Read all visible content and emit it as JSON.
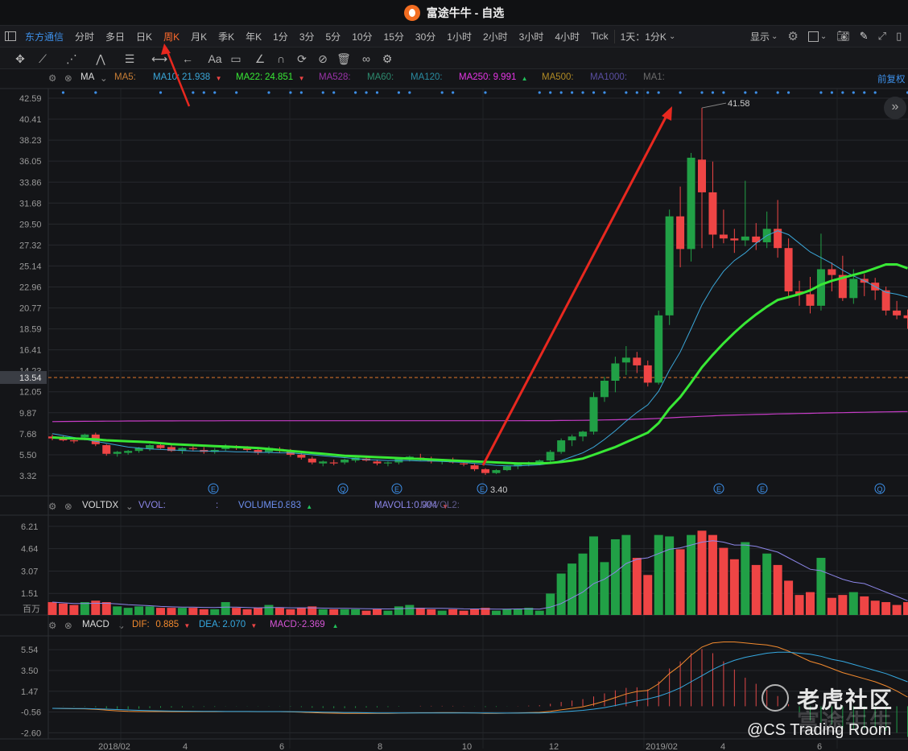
{
  "window": {
    "title": "富途牛牛 - 自选"
  },
  "toolbar": {
    "left_items": [
      {
        "label": "东方通信",
        "style": "blue"
      },
      {
        "label": "分时",
        "style": "normal"
      },
      {
        "label": "多日",
        "style": "normal"
      },
      {
        "label": "日K",
        "style": "normal"
      },
      {
        "label": "周K",
        "style": "active"
      },
      {
        "label": "月K",
        "style": "normal"
      },
      {
        "label": "季K",
        "style": "normal"
      },
      {
        "label": "年K",
        "style": "normal"
      },
      {
        "label": "1分",
        "style": "normal"
      },
      {
        "label": "3分",
        "style": "normal"
      },
      {
        "label": "5分",
        "style": "normal"
      },
      {
        "label": "10分",
        "style": "normal"
      },
      {
        "label": "15分",
        "style": "normal"
      },
      {
        "label": "30分",
        "style": "normal"
      },
      {
        "label": "1小时",
        "style": "normal"
      },
      {
        "label": "2小时",
        "style": "normal"
      },
      {
        "label": "3小时",
        "style": "normal"
      },
      {
        "label": "4小时",
        "style": "normal"
      },
      {
        "label": "Tick",
        "style": "normal"
      },
      {
        "label": "1天：1分K",
        "style": "normal"
      }
    ],
    "display_label": "显示"
  },
  "ma_bar": {
    "name": "MA",
    "items": [
      {
        "label": "MA5:",
        "value": "",
        "color": "#c87d35"
      },
      {
        "label": "MA10:",
        "value": "21.938",
        "color": "#3aa6d8",
        "arrow": "▼"
      },
      {
        "label": "MA22:",
        "value": "24.851",
        "color": "#38e835",
        "arrow": "▼"
      },
      {
        "label": "MA528:",
        "value": "",
        "color": "#9a33a8"
      },
      {
        "label": "MA60:",
        "value": "",
        "color": "#2d8a6e"
      },
      {
        "label": "MA120:",
        "value": "",
        "color": "#2a8ba0"
      },
      {
        "label": "MA250:",
        "value": "9.991",
        "color": "#e436e4",
        "arrow": "▲"
      },
      {
        "label": "MA500:",
        "value": "",
        "color": "#b08a25"
      },
      {
        "label": "MA1000:",
        "value": "",
        "color": "#5a4ea0"
      },
      {
        "label": "MA1:",
        "value": "",
        "color": "#6b6b6b"
      }
    ],
    "right_label": "前复权"
  },
  "vol_bar": {
    "name": "VOLTDX",
    "items": [
      {
        "label": "VVOL:",
        "value": "",
        "color": "#8c86e8"
      },
      {
        "label": ":",
        "value": "",
        "color": "#8c86e8"
      },
      {
        "label": "VOLUME:",
        "value": "0.883",
        "color": "#6d8ff0",
        "arrow": "▲"
      },
      {
        "label": "MAVOL1:",
        "value": "0.904",
        "color": "#8c86e8",
        "arrow": "▼"
      },
      {
        "label": "MAVOL2:",
        "value": "",
        "color": "#5f5a8a"
      }
    ]
  },
  "macd_bar": {
    "name": "MACD",
    "items": [
      {
        "label": "DIF:",
        "value": "0.885",
        "color": "#f28a2e",
        "arrow": "▼"
      },
      {
        "label": "DEA:",
        "value": "2.070",
        "color": "#35a8e0",
        "arrow": "▼"
      },
      {
        "label": "MACD:",
        "value": "-2.369",
        "color": "#d655d6",
        "arrow": "▲"
      }
    ]
  },
  "colors": {
    "up": "#ef4545",
    "down": "#21a046",
    "bg": "#141518",
    "grid": "#26282d",
    "accent": "#3d8fe8",
    "ma10": "#3aa6d8",
    "ma22": "#38e835",
    "ma250": "#c63cc6",
    "dif": "#f28a2e",
    "dea": "#35a8e0",
    "vol_ma": "#8c86e8"
  },
  "main_axis": {
    "ticks": [
      "42.59",
      "40.41",
      "38.23",
      "36.05",
      "33.86",
      "31.68",
      "29.50",
      "27.32",
      "25.14",
      "22.96",
      "20.77",
      "18.59",
      "16.41",
      "14.23",
      "12.05",
      "9.87",
      "7.68",
      "5.50",
      "3.32"
    ],
    "current_price": "13.54"
  },
  "vol_axis": {
    "ticks": [
      "6.21",
      "4.64",
      "3.07",
      "1.51"
    ],
    "unit": "百万"
  },
  "macd_axis": {
    "ticks": [
      "5.54",
      "3.50",
      "1.47",
      "-0.56",
      "-2.60"
    ]
  },
  "x_axis": {
    "labels": [
      "2018/02",
      "4",
      "6",
      "8",
      "10",
      "12",
      "2019/02",
      "4",
      "6"
    ]
  },
  "annotations": {
    "high_label": "41.58",
    "low_label": "3.40",
    "event_markers": [
      "E",
      "Q",
      "E",
      "E",
      "E",
      "E",
      "Q"
    ]
  },
  "watermark": {
    "brand": "老虎社区",
    "brand2": "富途牛牛",
    "handle": "@CS Trading Room"
  },
  "chart_data": {
    "type": "candlestick",
    "series_note": "Weekly candles; each row [open, high, low, close, volume_millions]",
    "candles": [
      [
        7.4,
        7.6,
        7.0,
        7.2,
        0.9
      ],
      [
        7.2,
        7.5,
        6.9,
        7.0,
        0.8
      ],
      [
        7.0,
        7.3,
        6.7,
        6.9,
        0.7
      ],
      [
        7.3,
        7.7,
        7.0,
        7.6,
        0.9
      ],
      [
        7.6,
        7.8,
        6.4,
        6.6,
        1.0
      ],
      [
        6.5,
        6.6,
        5.4,
        5.6,
        0.9
      ],
      [
        5.6,
        5.9,
        5.3,
        5.8,
        0.6
      ],
      [
        5.7,
        6.0,
        5.5,
        5.9,
        0.5
      ],
      [
        5.9,
        6.3,
        5.7,
        6.2,
        0.6
      ],
      [
        6.1,
        6.6,
        5.9,
        6.5,
        0.6
      ],
      [
        6.5,
        6.7,
        6.1,
        6.2,
        0.5
      ],
      [
        6.3,
        6.5,
        5.8,
        5.9,
        0.5
      ],
      [
        5.9,
        6.3,
        5.6,
        6.2,
        0.5
      ],
      [
        6.2,
        6.4,
        5.9,
        6.1,
        0.5
      ],
      [
        6.0,
        6.3,
        5.6,
        5.8,
        0.4
      ],
      [
        5.8,
        6.2,
        5.6,
        6.0,
        0.4
      ],
      [
        6.1,
        6.6,
        5.9,
        6.4,
        0.9
      ],
      [
        6.4,
        6.5,
        6.0,
        6.2,
        0.5
      ],
      [
        6.2,
        6.4,
        5.8,
        6.0,
        0.4
      ],
      [
        6.0,
        6.2,
        5.5,
        5.7,
        0.5
      ],
      [
        5.8,
        6.4,
        5.6,
        6.2,
        0.7
      ],
      [
        6.1,
        6.3,
        5.7,
        5.9,
        0.5
      ],
      [
        5.9,
        6.1,
        5.3,
        5.5,
        0.4
      ],
      [
        5.5,
        5.7,
        5.0,
        5.2,
        0.5
      ],
      [
        5.1,
        5.3,
        4.5,
        4.7,
        0.6
      ],
      [
        4.6,
        4.9,
        4.3,
        4.8,
        0.4
      ],
      [
        4.7,
        5.0,
        4.4,
        4.6,
        0.4
      ],
      [
        4.7,
        5.1,
        4.5,
        5.0,
        0.4
      ],
      [
        4.9,
        5.3,
        4.7,
        5.2,
        0.4
      ],
      [
        5.1,
        5.3,
        4.8,
        4.9,
        0.3
      ],
      [
        4.8,
        5.0,
        4.4,
        4.6,
        0.4
      ],
      [
        4.6,
        4.8,
        4.3,
        4.7,
        0.3
      ],
      [
        4.7,
        5.2,
        4.5,
        5.1,
        0.6
      ],
      [
        5.0,
        5.4,
        4.8,
        5.3,
        0.7
      ],
      [
        5.2,
        5.6,
        4.9,
        5.1,
        0.5
      ],
      [
        5.0,
        5.3,
        4.6,
        4.8,
        0.4
      ],
      [
        4.8,
        5.0,
        4.5,
        4.9,
        0.3
      ],
      [
        4.9,
        5.2,
        4.6,
        4.7,
        0.4
      ],
      [
        4.6,
        4.8,
        4.3,
        4.5,
        0.3
      ],
      [
        4.4,
        4.6,
        3.8,
        4.0,
        0.4
      ],
      [
        4.0,
        4.1,
        3.4,
        3.6,
        0.5
      ],
      [
        3.6,
        4.0,
        3.5,
        3.9,
        0.3
      ],
      [
        3.9,
        4.4,
        3.8,
        4.3,
        0.4
      ],
      [
        4.3,
        4.6,
        4.0,
        4.5,
        0.4
      ],
      [
        4.5,
        4.8,
        4.3,
        4.6,
        0.5
      ],
      [
        4.6,
        5.0,
        4.4,
        4.9,
        0.3
      ],
      [
        4.9,
        6.0,
        4.7,
        5.8,
        1.5
      ],
      [
        5.8,
        7.2,
        5.6,
        7.0,
        2.9
      ],
      [
        7.0,
        7.6,
        6.4,
        7.4,
        3.6
      ],
      [
        7.4,
        8.0,
        6.9,
        7.9,
        4.3
      ],
      [
        7.9,
        12.0,
        7.6,
        11.5,
        5.5
      ],
      [
        11.5,
        13.6,
        11.0,
        13.2,
        3.7
      ],
      [
        13.2,
        15.7,
        12.0,
        15.0,
        5.3
      ],
      [
        15.1,
        16.8,
        13.8,
        15.6,
        5.6
      ],
      [
        15.6,
        16.2,
        14.0,
        14.8,
        4.0
      ],
      [
        14.8,
        15.3,
        12.6,
        13.0,
        2.8
      ],
      [
        13.0,
        20.5,
        12.8,
        20.0,
        5.6
      ],
      [
        20.0,
        31.0,
        19.0,
        30.3,
        5.5
      ],
      [
        30.3,
        33.4,
        25.0,
        26.9,
        4.6
      ],
      [
        26.9,
        36.9,
        25.6,
        36.4,
        5.6
      ],
      [
        36.2,
        41.58,
        27.0,
        32.8,
        5.9
      ],
      [
        32.8,
        36.0,
        27.0,
        28.4,
        5.6
      ],
      [
        28.4,
        31.0,
        27.5,
        28.0,
        4.7
      ],
      [
        28.0,
        29.0,
        26.5,
        27.8,
        3.9
      ],
      [
        27.8,
        34.0,
        27.2,
        28.2,
        5.1
      ],
      [
        28.2,
        29.6,
        26.8,
        27.6,
        3.5
      ],
      [
        27.6,
        30.8,
        27.0,
        29.0,
        4.3
      ],
      [
        29.0,
        32.0,
        26.0,
        27.0,
        3.5
      ],
      [
        27.0,
        28.0,
        21.8,
        22.5,
        2.4
      ],
      [
        22.5,
        23.6,
        21.0,
        22.2,
        1.4
      ],
      [
        22.2,
        24.0,
        20.2,
        21.0,
        1.6
      ],
      [
        21.0,
        28.5,
        20.5,
        24.8,
        4.0
      ],
      [
        24.8,
        25.5,
        22.5,
        24.2,
        1.2
      ],
      [
        24.2,
        26.2,
        21.5,
        21.8,
        1.4
      ],
      [
        21.8,
        24.8,
        21.2,
        23.8,
        1.6
      ],
      [
        23.8,
        24.3,
        22.0,
        23.4,
        1.3
      ],
      [
        23.4,
        23.9,
        21.6,
        22.6,
        1.0
      ],
      [
        22.6,
        23.0,
        20.0,
        20.5,
        0.9
      ],
      [
        20.5,
        21.5,
        19.6,
        20.0,
        0.7
      ],
      [
        20.0,
        20.6,
        18.6,
        19.7,
        0.9
      ]
    ],
    "ma10": [
      7.7,
      7.5,
      7.3,
      7.1,
      6.9,
      6.7,
      6.5,
      6.3,
      6.2,
      6.1,
      6.05,
      6.0,
      5.95,
      5.9,
      5.9,
      5.85,
      5.85,
      5.8,
      5.8,
      5.75,
      5.75,
      5.7,
      5.7,
      5.6,
      5.5,
      5.4,
      5.3,
      5.2,
      5.1,
      5.0,
      4.95,
      4.9,
      4.9,
      4.9,
      4.85,
      4.85,
      4.8,
      4.75,
      4.7,
      4.6,
      4.5,
      4.4,
      4.35,
      4.35,
      4.4,
      4.45,
      4.6,
      4.9,
      5.3,
      5.7,
      6.3,
      7.1,
      8.0,
      9.0,
      9.9,
      10.7,
      12.1,
      14.3,
      16.2,
      18.6,
      21.1,
      23.0,
      24.6,
      25.7,
      26.5,
      27.5,
      28.3,
      28.8,
      28.4,
      27.5,
      26.6,
      26.0,
      25.4,
      24.7,
      24.1,
      23.6,
      23.0,
      22.4,
      22.2,
      21.9
    ],
    "ma22": [
      7.3,
      7.25,
      7.2,
      7.15,
      7.1,
      7.0,
      6.95,
      6.9,
      6.85,
      6.8,
      6.7,
      6.6,
      6.55,
      6.5,
      6.45,
      6.4,
      6.35,
      6.3,
      6.25,
      6.2,
      6.1,
      6.0,
      5.9,
      5.8,
      5.7,
      5.6,
      5.5,
      5.4,
      5.35,
      5.3,
      5.25,
      5.2,
      5.15,
      5.1,
      5.05,
      5.0,
      4.95,
      4.9,
      4.85,
      4.8,
      4.75,
      4.7,
      4.65,
      4.6,
      4.6,
      4.6,
      4.65,
      4.75,
      4.9,
      5.1,
      5.5,
      5.9,
      6.3,
      6.8,
      7.3,
      7.8,
      8.8,
      10.3,
      11.5,
      13.0,
      14.6,
      15.9,
      17.1,
      18.2,
      19.2,
      20.1,
      20.9,
      21.6,
      21.9,
      22.2,
      22.6,
      23.2,
      23.6,
      23.9,
      24.2,
      24.5,
      24.9,
      25.3,
      25.3,
      24.9
    ],
    "ma250": [
      8.95,
      8.96,
      8.97,
      8.98,
      8.99,
      9.0,
      9.0,
      9.01,
      9.01,
      9.02,
      9.02,
      9.02,
      9.03,
      9.03,
      9.03,
      9.03,
      9.04,
      9.04,
      9.04,
      9.04,
      9.04,
      9.04,
      9.04,
      9.04,
      9.04,
      9.04,
      9.04,
      9.04,
      9.04,
      9.04,
      9.04,
      9.04,
      9.04,
      9.04,
      9.04,
      9.04,
      9.04,
      9.04,
      9.04,
      9.04,
      9.04,
      9.04,
      9.04,
      9.04,
      9.05,
      9.05,
      9.05,
      9.06,
      9.07,
      9.08,
      9.1,
      9.12,
      9.14,
      9.17,
      9.2,
      9.23,
      9.28,
      9.34,
      9.4,
      9.45,
      9.5,
      9.55,
      9.6,
      9.63,
      9.66,
      9.69,
      9.72,
      9.75,
      9.77,
      9.79,
      9.81,
      9.84,
      9.86,
      9.88,
      9.9,
      9.92,
      9.94,
      9.96,
      9.98,
      9.99
    ],
    "vol_ma": [
      0.9,
      0.85,
      0.8,
      0.8,
      0.82,
      0.82,
      0.78,
      0.72,
      0.68,
      0.65,
      0.6,
      0.57,
      0.55,
      0.55,
      0.53,
      0.52,
      0.55,
      0.55,
      0.52,
      0.5,
      0.52,
      0.52,
      0.5,
      0.5,
      0.5,
      0.48,
      0.47,
      0.46,
      0.45,
      0.44,
      0.43,
      0.42,
      0.44,
      0.46,
      0.47,
      0.47,
      0.46,
      0.45,
      0.43,
      0.42,
      0.42,
      0.41,
      0.41,
      0.42,
      0.42,
      0.41,
      0.55,
      0.8,
      1.2,
      1.6,
      2.2,
      2.5,
      3.0,
      3.6,
      3.9,
      4.0,
      4.3,
      4.6,
      4.7,
      4.9,
      5.1,
      5.2,
      5.1,
      4.9,
      4.9,
      4.8,
      4.6,
      4.4,
      4.0,
      3.6,
      3.2,
      3.1,
      2.8,
      2.5,
      2.3,
      2.2,
      1.9,
      1.6,
      1.3,
      1.0
    ],
    "dif": [
      -0.2,
      -0.22,
      -0.24,
      -0.25,
      -0.3,
      -0.38,
      -0.45,
      -0.5,
      -0.52,
      -0.52,
      -0.52,
      -0.53,
      -0.53,
      -0.53,
      -0.53,
      -0.53,
      -0.52,
      -0.52,
      -0.52,
      -0.53,
      -0.53,
      -0.53,
      -0.55,
      -0.58,
      -0.62,
      -0.65,
      -0.68,
      -0.7,
      -0.7,
      -0.7,
      -0.7,
      -0.7,
      -0.68,
      -0.66,
      -0.64,
      -0.64,
      -0.63,
      -0.63,
      -0.64,
      -0.66,
      -0.7,
      -0.7,
      -0.68,
      -0.66,
      -0.63,
      -0.6,
      -0.5,
      -0.35,
      -0.2,
      -0.05,
      0.2,
      0.5,
      0.85,
      1.2,
      1.45,
      1.55,
      2.2,
      3.2,
      4.0,
      5.0,
      5.8,
      6.2,
      6.3,
      6.3,
      6.2,
      6.1,
      6.0,
      5.8,
      5.4,
      4.9,
      4.4,
      4.1,
      3.7,
      3.3,
      3.0,
      2.7,
      2.4,
      2.0,
      1.5,
      0.9
    ],
    "dea": [
      -0.2,
      -0.21,
      -0.22,
      -0.23,
      -0.25,
      -0.28,
      -0.32,
      -0.36,
      -0.4,
      -0.43,
      -0.45,
      -0.47,
      -0.48,
      -0.49,
      -0.5,
      -0.5,
      -0.51,
      -0.51,
      -0.51,
      -0.52,
      -0.52,
      -0.52,
      -0.53,
      -0.54,
      -0.55,
      -0.57,
      -0.59,
      -0.61,
      -0.62,
      -0.64,
      -0.65,
      -0.66,
      -0.66,
      -0.66,
      -0.66,
      -0.66,
      -0.65,
      -0.65,
      -0.65,
      -0.65,
      -0.66,
      -0.67,
      -0.67,
      -0.67,
      -0.66,
      -0.65,
      -0.62,
      -0.56,
      -0.48,
      -0.4,
      -0.28,
      -0.13,
      0.07,
      0.3,
      0.52,
      0.72,
      0.98,
      1.35,
      1.8,
      2.4,
      3.0,
      3.6,
      4.1,
      4.5,
      4.8,
      5.0,
      5.2,
      5.3,
      5.3,
      5.2,
      5.1,
      4.9,
      4.6,
      4.4,
      4.1,
      3.8,
      3.5,
      3.2,
      2.8,
      2.4
    ]
  }
}
